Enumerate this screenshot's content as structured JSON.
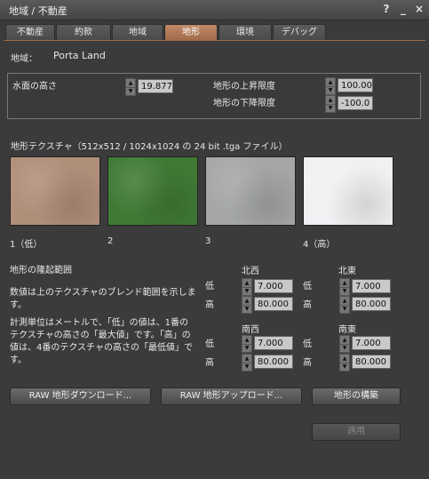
{
  "window": {
    "title": "地域 / 不動産",
    "help_glyph": "?",
    "minimize_glyph": "_",
    "close_glyph": "×"
  },
  "tabs": [
    {
      "label": "不動産"
    },
    {
      "label": "約款"
    },
    {
      "label": "地域"
    },
    {
      "label": "地形",
      "active": true
    },
    {
      "label": "環境"
    },
    {
      "label": "デバッグ"
    }
  ],
  "region": {
    "label": "地域：",
    "name": "Porta Land"
  },
  "water": {
    "label": "水面の高さ",
    "value": "19.877"
  },
  "terrain_limits": {
    "raise_label": "地形の上昇限度",
    "raise_value": "100.00",
    "lower_label": "地形の下降限度",
    "lower_value": "-100.0"
  },
  "textures": {
    "heading": "地形テクスチャ（512x512 / 1024x1024 の 24 bit .tga ファイル）",
    "items": [
      {
        "label": "1（低）",
        "color": "#b08f7a"
      },
      {
        "label": "2",
        "color": "#3f7a34"
      },
      {
        "label": "3",
        "color": "#a4a7a6"
      },
      {
        "label": "4（高）",
        "color": "#f0f1f3"
      }
    ]
  },
  "elevation": {
    "heading": "地形の隆起範囲",
    "desc1": "数値は上のテクスチャのブレンド範囲を示します。",
    "desc2": "計測単位はメートルで、「低」の値は、1番のテクスチャの高さの「最大値」です。「高」の値は、4番のテクスチャの高さの「最低値」です。",
    "low_label": "低",
    "high_label": "高",
    "corners": {
      "nw": {
        "label": "北西",
        "low": "7.000",
        "high": "80.000"
      },
      "ne": {
        "label": "北東",
        "low": "7.000",
        "high": "80.000"
      },
      "sw": {
        "label": "南西",
        "low": "7.000",
        "high": "80.000"
      },
      "se": {
        "label": "南東",
        "low": "7.000",
        "high": "80.000"
      }
    }
  },
  "buttons": {
    "download": "RAW 地形ダウンロード...",
    "upload": "RAW 地形アップロード...",
    "bake": "地形の構築",
    "apply": "適用"
  }
}
